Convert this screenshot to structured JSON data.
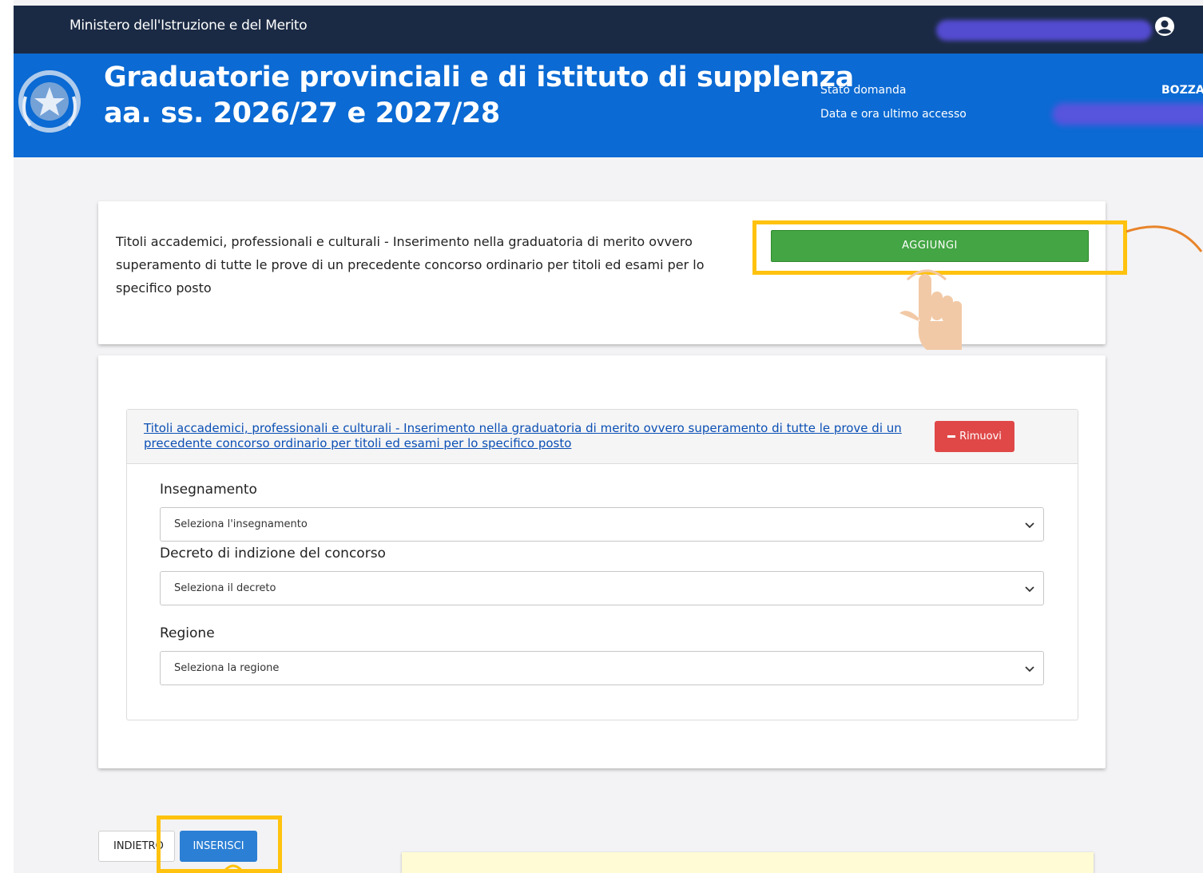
{
  "topbar": {
    "ministry": "Ministero dell'Istruzione e del Merito",
    "user_icon": "user-circle-icon"
  },
  "header": {
    "title_line1": "Graduatorie provinciali e di istituto di supplenza",
    "title_line2": "aa. ss. 2026/27 e 2027/28",
    "status_label": "Stato domanda",
    "status_value": "BOZZA",
    "access_label": "Data e ora ultimo accesso",
    "emblem_icon": "italian-republic-emblem-icon"
  },
  "card": {
    "description": "Titoli accademici, professionali e culturali - Inserimento nella graduatoria di merito ovvero superamento di tutte le prove di un precedente concorso ordinario per titoli ed esami per lo specifico posto",
    "add_label": "AGGIUNGI"
  },
  "section": {
    "link": "Titoli accademici, professionali e culturali - Inserimento nella graduatoria di merito ovvero superamento di tutte le prove di un precedente concorso ordinario per titoli ed esami per lo specifico posto",
    "remove_label": "Rimuovi",
    "fields": [
      {
        "label": "Insegnamento",
        "placeholder": "Seleziona l'insegnamento"
      },
      {
        "label": "Decreto di indizione del concorso",
        "placeholder": "Seleziona il decreto"
      },
      {
        "label": "Regione",
        "placeholder": "Seleziona la regione"
      }
    ]
  },
  "footer": {
    "back_label": "INDIETRO",
    "insert_label": "INSERISCI"
  },
  "colors": {
    "topbar": "#1b2a44",
    "header": "#0b6ad3",
    "add_button": "#43a543",
    "remove_button": "#e04848",
    "insert_button": "#2b7fd4",
    "highlight": "#ffc20e"
  }
}
